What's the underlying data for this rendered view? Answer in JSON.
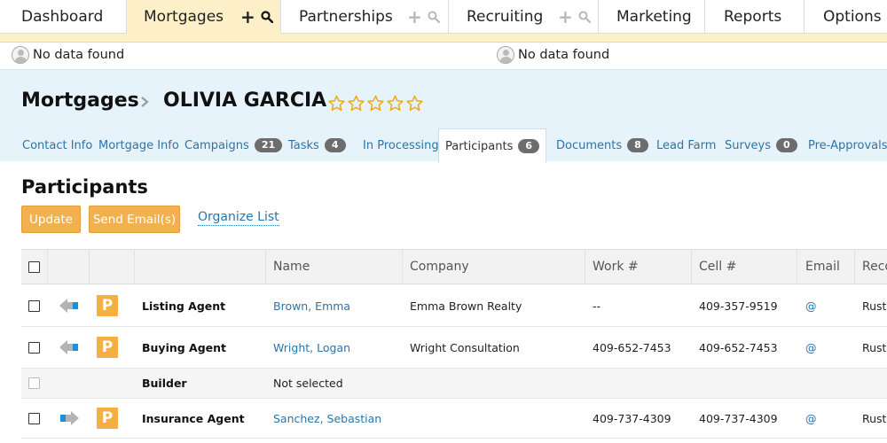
{
  "topnav": {
    "items": [
      {
        "label": "Dashboard"
      },
      {
        "label": "Mortgages",
        "active": true
      },
      {
        "label": "Partnerships"
      },
      {
        "label": "Recruiting"
      },
      {
        "label": "Marketing"
      },
      {
        "label": "Reports"
      },
      {
        "label": "Options"
      }
    ]
  },
  "notices": [
    {
      "text": "No data found"
    },
    {
      "text": "No data found"
    }
  ],
  "record": {
    "breadcrumb": "Mortgages",
    "name": "OLIVIA GARCIA",
    "rating": 0,
    "rating_max": 5,
    "star_color": "#f0a818"
  },
  "subtabs": [
    {
      "label": "Contact Info"
    },
    {
      "label": "Mortgage Info"
    },
    {
      "label": "Campaigns",
      "count": "21"
    },
    {
      "label": "Tasks",
      "count": "4"
    },
    {
      "label": "In Processing"
    },
    {
      "label": "Participants",
      "count": "6",
      "active": true
    },
    {
      "label": "Documents",
      "count": "8"
    },
    {
      "label": "Lead Farm"
    },
    {
      "label": "Surveys",
      "count": "0"
    },
    {
      "label": "Pre-Approvals"
    }
  ],
  "section": {
    "title": "Participants",
    "update_label": "Update",
    "send_email_label": "Send Email(s)",
    "organize_label": "Organize List"
  },
  "table": {
    "columns": {
      "name": "Name",
      "company": "Company",
      "work": "Work #",
      "cell": "Cell #",
      "email": "Email",
      "reco": "Reco"
    },
    "rows": [
      {
        "role": "Listing Agent",
        "name": "Brown, Emma",
        "company": "Emma Brown Realty",
        "work": "--",
        "cell": "409-357-9519",
        "email": "@",
        "reco": "Rusty",
        "direction": "left",
        "has_person": true
      },
      {
        "role": "Buying Agent",
        "name": "Wright, Logan",
        "company": "Wright Consultation",
        "work": "409-652-7453",
        "cell": "409-652-7453",
        "email": "@",
        "reco": "Rusty",
        "direction": "left",
        "has_person": true
      },
      {
        "role": "Builder",
        "name_placeholder": "Not selected",
        "has_person": false
      },
      {
        "role": "Insurance Agent",
        "name": "Sanchez, Sebastian",
        "company": "",
        "work": "409-737-4309",
        "cell": "409-737-4309",
        "email": "@",
        "reco": "Rusty",
        "direction": "right",
        "has_person": true
      }
    ]
  }
}
